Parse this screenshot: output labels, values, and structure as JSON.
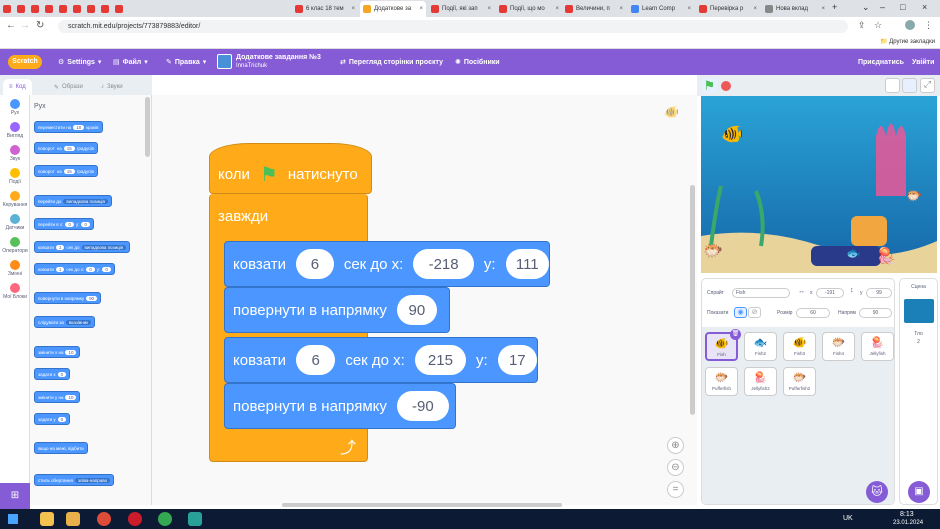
{
  "browser": {
    "tabs": [
      {
        "label": "",
        "color": "#e53935"
      },
      {
        "label": "",
        "color": "#e53935"
      },
      {
        "label": "",
        "color": "#e53935"
      },
      {
        "label": "",
        "color": "#e53935"
      },
      {
        "label": "",
        "color": "#e53935"
      },
      {
        "label": "",
        "color": "#e53935"
      },
      {
        "label": "",
        "color": "#e53935"
      },
      {
        "label": "",
        "color": "#e53935"
      },
      {
        "label": "",
        "color": "#e53935"
      },
      {
        "label": "6 клас 18 тем",
        "color": "#e53935"
      },
      {
        "label": "Додаткове за",
        "color": "#f5a623",
        "active": true
      },
      {
        "label": "Події, які зап",
        "color": "#e53935"
      },
      {
        "label": "Події, що мо",
        "color": "#e53935"
      },
      {
        "label": "Величини, п",
        "color": "#e53935"
      },
      {
        "label": "Learn Comp",
        "color": "#4285f4"
      },
      {
        "label": "Перевірка р",
        "color": "#e53935"
      },
      {
        "label": "Нова вклад",
        "color": "#888888"
      }
    ],
    "url": "scratch.mit.edu/projects/773879883/editor/",
    "bookmarks_label": "Другие закладки"
  },
  "menu": {
    "logo": "Scratch",
    "settings": "Settings",
    "file": "Файл",
    "edit": "Правка",
    "project_title": "Додаткове завдання №3",
    "author": "InnaTrichuk",
    "see_project": "Перегляд сторінки проєкту",
    "tutorials": "Посібники",
    "join": "Приєднатись",
    "signin": "Увійти"
  },
  "tabs": {
    "code": "Код",
    "costumes": "Образи",
    "sounds": "Звуки"
  },
  "categories": [
    {
      "label": "Рух",
      "color": "#4c97ff"
    },
    {
      "label": "Вигляд",
      "color": "#9966ff"
    },
    {
      "label": "Звук",
      "color": "#cf63cf"
    },
    {
      "label": "Події",
      "color": "#ffbf00"
    },
    {
      "label": "Керування",
      "color": "#ffab19"
    },
    {
      "label": "Датчики",
      "color": "#5cb1d6"
    },
    {
      "label": "Оператори",
      "color": "#59c059"
    },
    {
      "label": "Змінні",
      "color": "#ff8c1a"
    },
    {
      "label": "Мої Блоки",
      "color": "#ff6680"
    }
  ],
  "palette": {
    "heading": "Рух",
    "blocks": [
      {
        "parts": [
          "переместити на",
          "10",
          "кроків"
        ]
      },
      {
        "parts": [
          "поворот",
          "на",
          "15",
          "градусів"
        ]
      },
      {
        "parts": [
          "поворот",
          "на",
          "15",
          "градусів"
        ]
      },
      {
        "parts": [
          "перейти до",
          "випадкова позиція"
        ]
      },
      {
        "parts": [
          "перейти в x:",
          "0",
          "y:",
          "0"
        ]
      },
      {
        "parts": [
          "ковзати",
          "1",
          "сек до",
          "випадкова позиція"
        ]
      },
      {
        "parts": [
          "ковзати",
          "1",
          "сек до x:",
          "0",
          "y:",
          "0"
        ]
      },
      {
        "parts": [
          "повернути в напрямку",
          "90"
        ]
      },
      {
        "parts": [
          "слідувати за",
          "вказівник"
        ]
      },
      {
        "parts": [
          "змінити x на",
          "10"
        ]
      },
      {
        "parts": [
          "задати x",
          "0"
        ]
      },
      {
        "parts": [
          "змінити y на",
          "10"
        ]
      },
      {
        "parts": [
          "задати y",
          "0"
        ]
      },
      {
        "parts": [
          "якщо на межі, відбити"
        ]
      },
      {
        "parts": [
          "стиль обертання",
          "зліва-направо"
        ]
      }
    ]
  },
  "script": {
    "hat": {
      "when": "коли",
      "clicked": "натиснуто"
    },
    "forever": "завжди",
    "blocks": [
      {
        "parts": [
          "ковзати",
          "6",
          "сек до x:",
          "-218",
          "y:",
          "111"
        ]
      },
      {
        "parts": [
          "повернути в напрямку",
          "90"
        ]
      },
      {
        "parts": [
          "ковзати",
          "6",
          "сек до x:",
          "215",
          "y:",
          "17"
        ]
      },
      {
        "parts": [
          "повернути в напрямку",
          "-90"
        ]
      }
    ]
  },
  "sprite_info": {
    "sprite_label": "Спрайт",
    "sprite_name": "Fish",
    "x_label": "x",
    "x": "-191",
    "y_label": "y",
    "y": "99",
    "show_label": "Показати",
    "size_label": "Розмір",
    "size": "60",
    "direction_label": "Напрям",
    "direction": "90"
  },
  "sprites": [
    {
      "name": "Fish",
      "icon": "🐠",
      "selected": true
    },
    {
      "name": "Fish2",
      "icon": "🐟"
    },
    {
      "name": "Fish3",
      "icon": "🐠"
    },
    {
      "name": "Fish4",
      "icon": "🐡"
    },
    {
      "name": "Jellyfish",
      "icon": "🪼"
    },
    {
      "name": "Pufferfish",
      "icon": "🐡"
    },
    {
      "name": "Jellyfish2",
      "icon": "🪼"
    },
    {
      "name": "Pufferfish2",
      "icon": "🐡"
    }
  ],
  "stage_panel": {
    "label": "Сцена",
    "backdrops_label": "Тло",
    "backdrops_count": "2"
  },
  "taskbar": {
    "lang": "UK",
    "time": "8:13",
    "date": "23.01.2024"
  }
}
